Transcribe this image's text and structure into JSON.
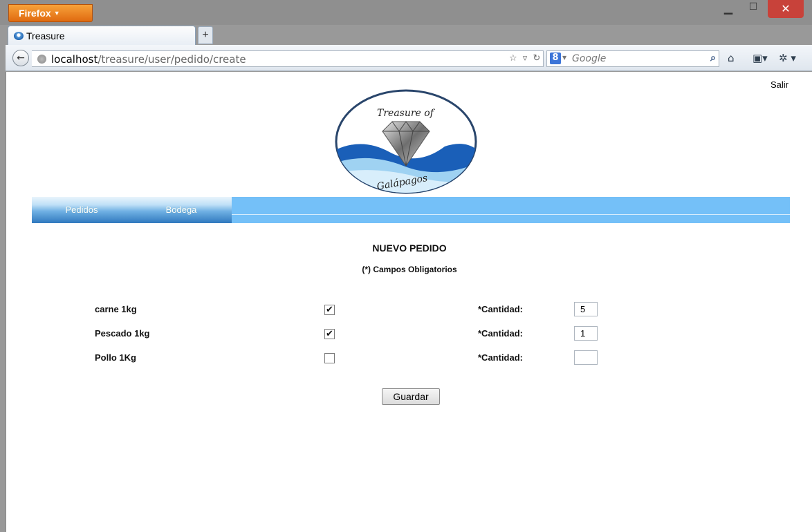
{
  "browser": {
    "menu_button": "Firefox",
    "tab_title": "Treasure",
    "new_tab_label": "+",
    "url_host": "localhost",
    "url_path": "/treasure/user/pedido/create",
    "search_placeholder": "Google",
    "search_engine_letter": "8"
  },
  "header": {
    "logout_link": "Salir",
    "logo_top_text": "Treasure of",
    "logo_bottom_text": "Galápagos"
  },
  "nav": {
    "items": [
      {
        "label": "Pedidos"
      },
      {
        "label": "Bodega"
      }
    ]
  },
  "form": {
    "title": "NUEVO PEDIDO",
    "subtitle": "(*) Campos Obligatorios",
    "rows": [
      {
        "product": "carne 1kg",
        "checked": true,
        "qty_label": "*Cantidad:",
        "qty_value": "5"
      },
      {
        "product": "Pescado 1kg",
        "checked": true,
        "qty_label": "*Cantidad:",
        "qty_value": "1"
      },
      {
        "product": "Pollo 1Kg",
        "checked": false,
        "qty_label": "*Cantidad:",
        "qty_value": ""
      }
    ],
    "submit_label": "Guardar"
  },
  "colors": {
    "menu_bar": "#74c0f8",
    "firefox_orange": "#e8801d",
    "close_red": "#c8423a"
  }
}
